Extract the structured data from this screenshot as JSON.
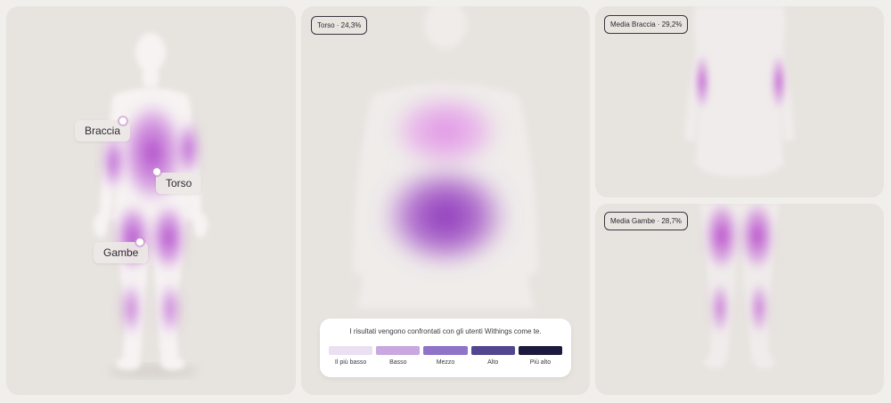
{
  "full_body": {
    "callouts": {
      "arms": "Braccia",
      "torso": "Torso",
      "legs": "Gambe"
    }
  },
  "torso_panel": {
    "badge": "Torso · 24,3%"
  },
  "arms_panel": {
    "badge": "Media Braccia · 29,2%"
  },
  "legs_panel": {
    "badge": "Media Gambe · 28,7%"
  },
  "legend": {
    "title": "I risultati vengono confrontati con gli utenti Withings come te.",
    "levels": [
      {
        "label": "Il più basso",
        "color": "#ebe0f2"
      },
      {
        "label": "Basso",
        "color": "#c9a7e0"
      },
      {
        "label": "Mezzo",
        "color": "#8f73c8"
      },
      {
        "label": "Alto",
        "color": "#534691"
      },
      {
        "label": "Più alto",
        "color": "#1d1a3f"
      }
    ]
  },
  "colors": {
    "accent_purple": "#a03cc4",
    "panel_bg": "#e7e3df"
  }
}
